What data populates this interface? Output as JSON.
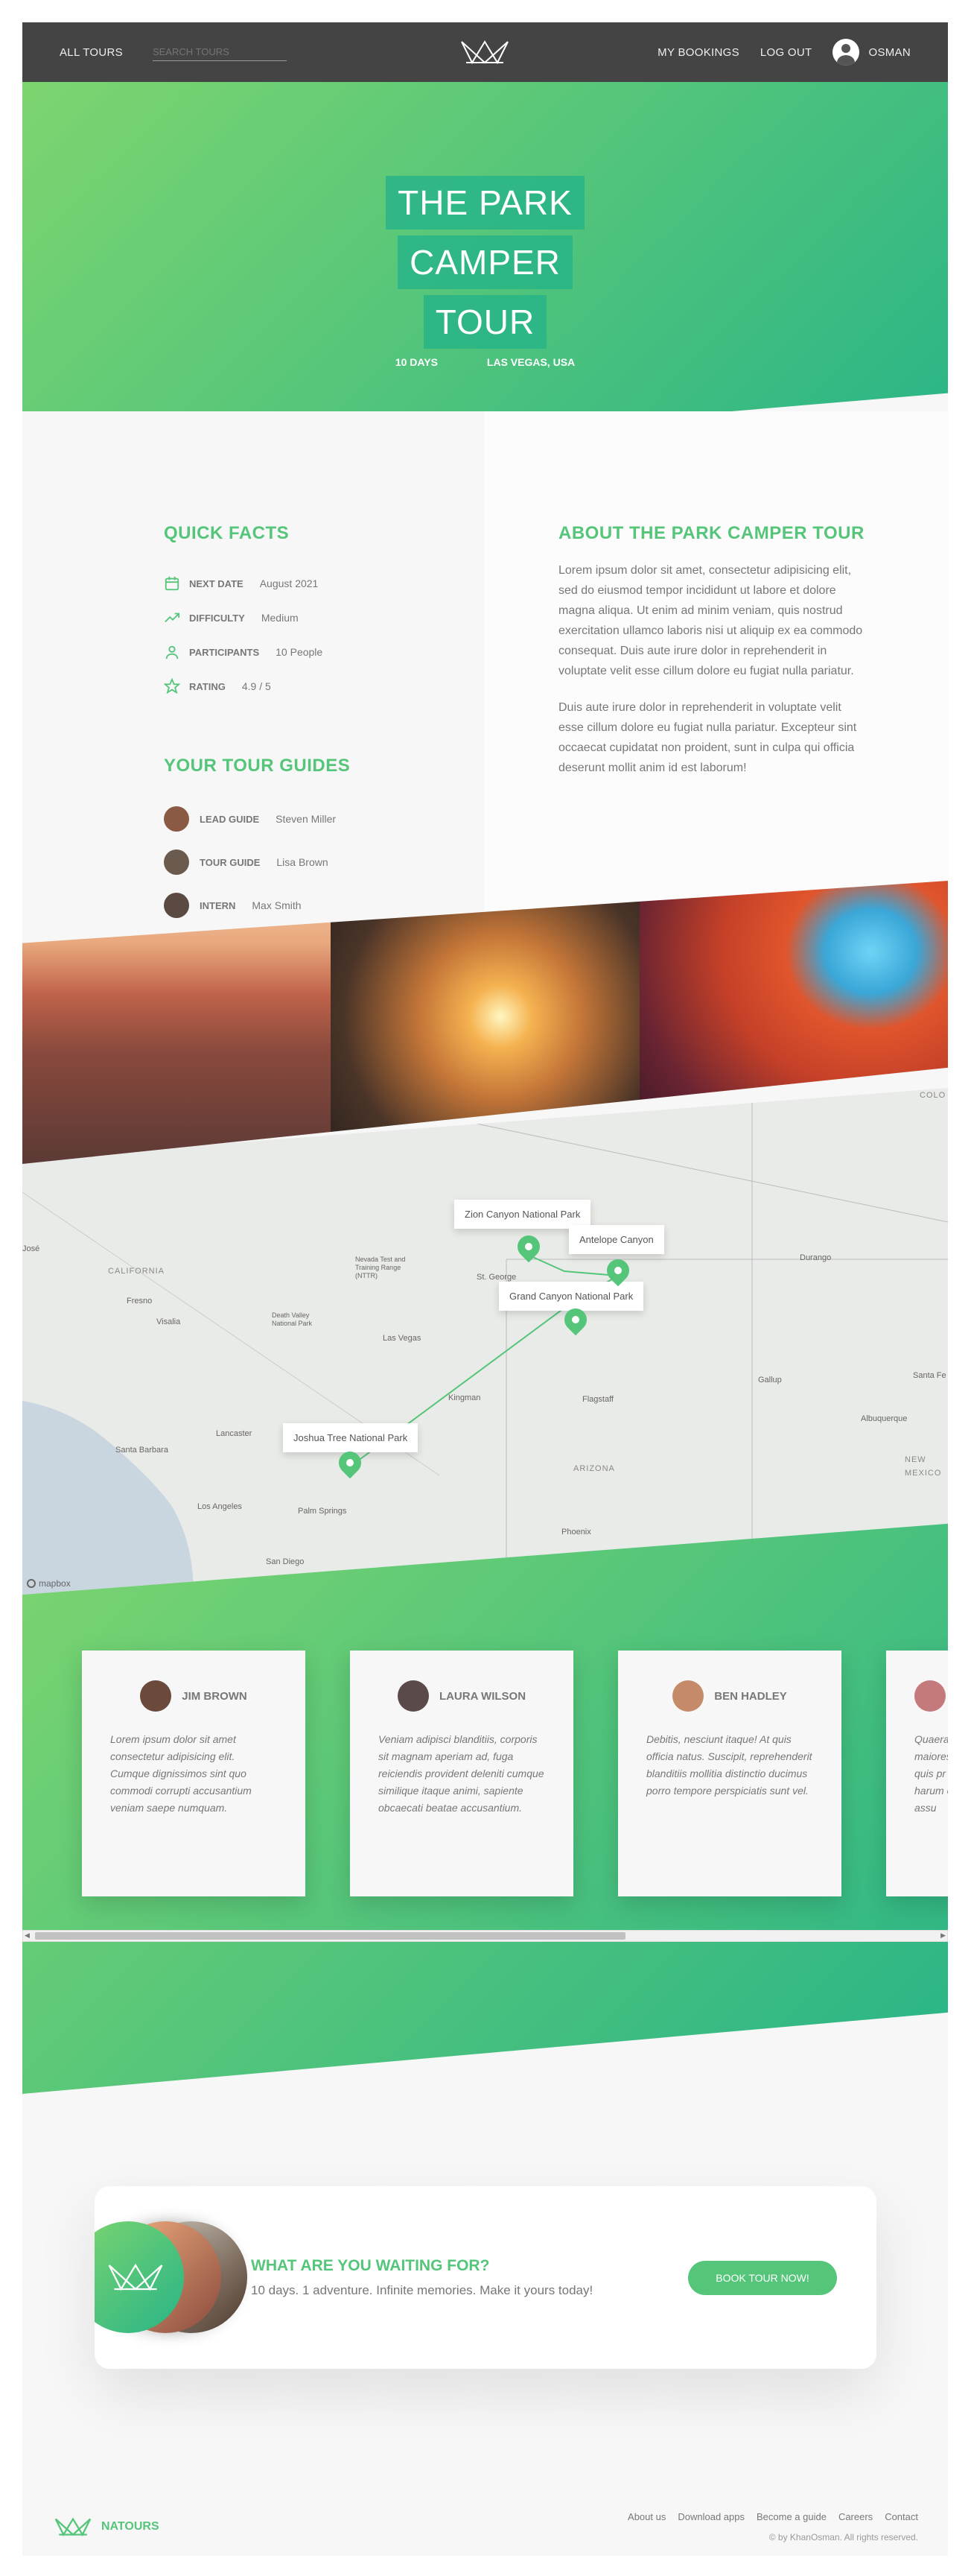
{
  "header": {
    "all_tours": "ALL TOURS",
    "search_placeholder": "SEARCH TOURS",
    "my_bookings": "MY BOOKINGS",
    "log_out": "LOG OUT",
    "user_name": "OSMAN"
  },
  "hero": {
    "title_lines": [
      "THE PARK",
      "CAMPER",
      "TOUR"
    ],
    "duration": "10 DAYS",
    "location": "LAS VEGAS, USA"
  },
  "quick_facts": {
    "title": "QUICK FACTS",
    "items": [
      {
        "label": "NEXT DATE",
        "value": "August 2021",
        "icon": "calendar-icon"
      },
      {
        "label": "DIFFICULTY",
        "value": "Medium",
        "icon": "trending-up-icon"
      },
      {
        "label": "PARTICIPANTS",
        "value": "10 People",
        "icon": "user-icon"
      },
      {
        "label": "RATING",
        "value": "4.9 / 5",
        "icon": "star-icon"
      }
    ]
  },
  "guides": {
    "title": "YOUR TOUR GUIDES",
    "items": [
      {
        "role": "LEAD GUIDE",
        "name": "Steven Miller",
        "color": "#8a5a44"
      },
      {
        "role": "TOUR GUIDE",
        "name": "Lisa Brown",
        "color": "#6b5a4e"
      },
      {
        "role": "INTERN",
        "name": "Max Smith",
        "color": "#5a4a42"
      }
    ]
  },
  "about": {
    "title": "ABOUT THE PARK CAMPER TOUR",
    "paragraphs": [
      "Lorem ipsum dolor sit amet, consectetur adipisicing elit, sed do eiusmod tempor incididunt ut labore et dolore magna aliqua. Ut enim ad minim veniam, quis nostrud exercitation ullamco laboris nisi ut aliquip ex ea commodo consequat. Duis aute irure dolor in reprehenderit in voluptate velit esse cillum dolore eu fugiat nulla pariatur.",
      "Duis aute irure dolor in reprehenderit in voluptate velit esse cillum dolore eu fugiat nulla pariatur. Excepteur sint occaecat cupidatat non proident, sunt in culpa qui officia deserunt mollit anim id est laborum!"
    ]
  },
  "map": {
    "popups": [
      "Zion Canyon National Park",
      "Antelope Canyon",
      "Grand Canyon National Park",
      "Joshua Tree National Park"
    ],
    "labels": {
      "california": "CALIFORNIA",
      "arizona": "ARIZONA",
      "new_mexico": "NEW MEXICO",
      "colo": "COLO"
    },
    "cities": [
      "Las Vegas",
      "Los Angeles",
      "San Diego",
      "Phoenix",
      "Flagstaff",
      "Fresno",
      "Visalia",
      "Lancaster",
      "Santa Barbara",
      "Palm Springs",
      "Kingman",
      "St. George",
      "Durango",
      "Gallup",
      "Albuquerque",
      "Santa Fe",
      "José",
      "Death Valley National Park",
      "Nevada Test and Training Range (NTTR)"
    ],
    "attribution": "mapbox"
  },
  "reviews": [
    {
      "name": "JIM BROWN",
      "text": "Lorem ipsum dolor sit amet consectetur adipisicing elit. Cumque dignissimos sint quo commodi corrupti accusantium veniam saepe numquam.",
      "color": "#6b4a3c"
    },
    {
      "name": "LAURA WILSON",
      "text": "Veniam adipisci blanditiis, corporis sit magnam aperiam ad, fuga reiciendis provident deleniti cumque similique itaque animi, sapiente obcaecati beatae accusantium.",
      "color": "#5a4a4a"
    },
    {
      "name": "BEN HADLEY",
      "text": "Debitis, nesciunt itaque! At quis officia natus. Suscipit, reprehenderit blanditiis mollitia distinctio ducimus porro tempore perspiciatis sunt vel.",
      "color": "#c48a6a"
    },
    {
      "name": "",
      "text": "Quaerat maiores quis pr harum ea assu",
      "color": "#c47a7a"
    }
  ],
  "cta": {
    "title": "WHAT ARE YOU WAITING FOR?",
    "subtitle": "10 days. 1 adventure. Infinite memories. Make it yours today!",
    "button": "BOOK TOUR NOW!"
  },
  "footer": {
    "brand": "NATOURS",
    "links": [
      "About us",
      "Download apps",
      "Become a guide",
      "Careers",
      "Contact"
    ],
    "copyright": "© by KhanOsman. All rights reserved."
  },
  "colors": {
    "primary": "#55c57a",
    "primary_dark": "#28b487",
    "header_bg": "#444444"
  }
}
